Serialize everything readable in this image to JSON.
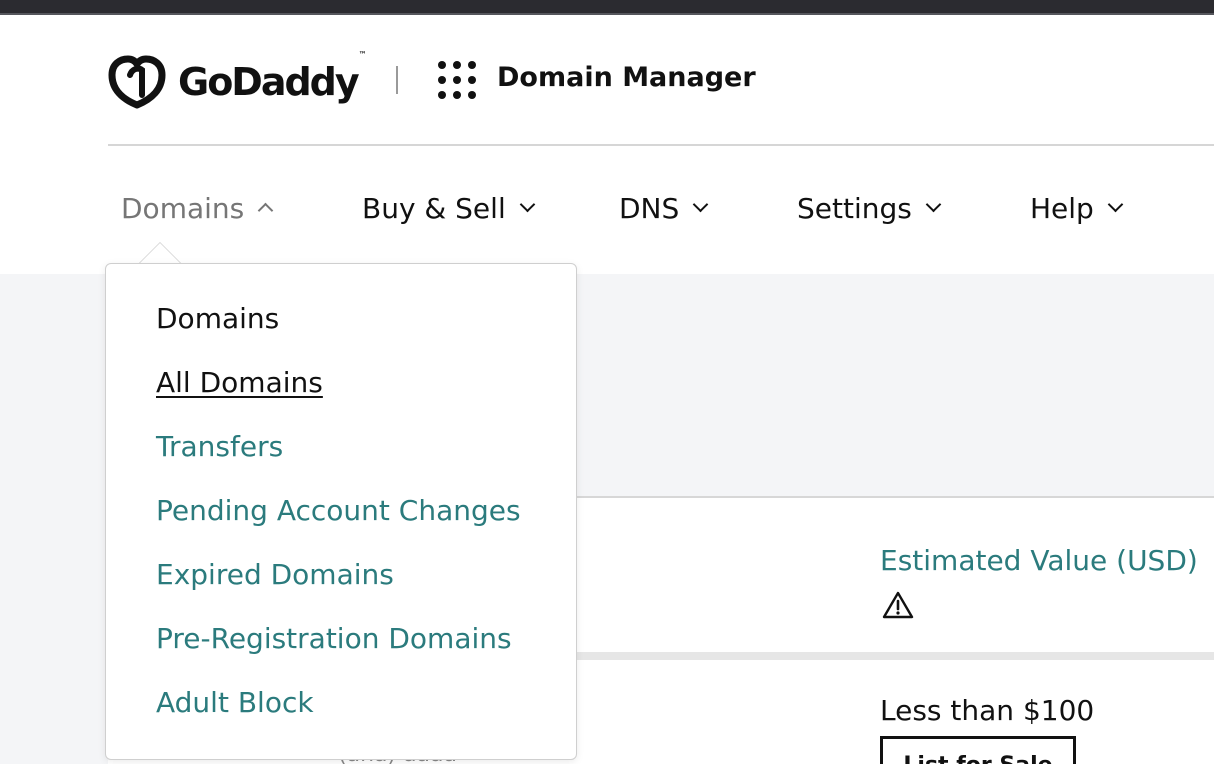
{
  "header": {
    "logo_text": "GoDaddy",
    "logo_tm": "™",
    "apps_icon": "grid-dots-icon",
    "app_title": "Domain Manager"
  },
  "nav": {
    "items": [
      {
        "label": "Domains",
        "state": "expanded"
      },
      {
        "label": "Buy & Sell",
        "state": "collapsed"
      },
      {
        "label": "DNS",
        "state": "collapsed"
      },
      {
        "label": "Settings",
        "state": "collapsed"
      },
      {
        "label": "Help",
        "state": "collapsed"
      }
    ]
  },
  "dropdown": {
    "heading": "Domains",
    "items": [
      {
        "label": "All Domains",
        "current": true
      },
      {
        "label": "Transfers"
      },
      {
        "label": "Pending Account Changes"
      },
      {
        "label": "Expired Domains"
      },
      {
        "label": "Pre-Registration Domains"
      },
      {
        "label": "Adult Block"
      }
    ]
  },
  "table": {
    "estimated_value_header": "Estimated Value (USD)",
    "header_icon": "warning-icon",
    "row_value": "Less than $100",
    "row_action_label": "List for Sale",
    "row_faded_text": "(ana) aaaa"
  },
  "colors": {
    "link": "#2b7b7d",
    "top_strip": "#2b2b30",
    "content_bg": "#f4f5f7"
  }
}
